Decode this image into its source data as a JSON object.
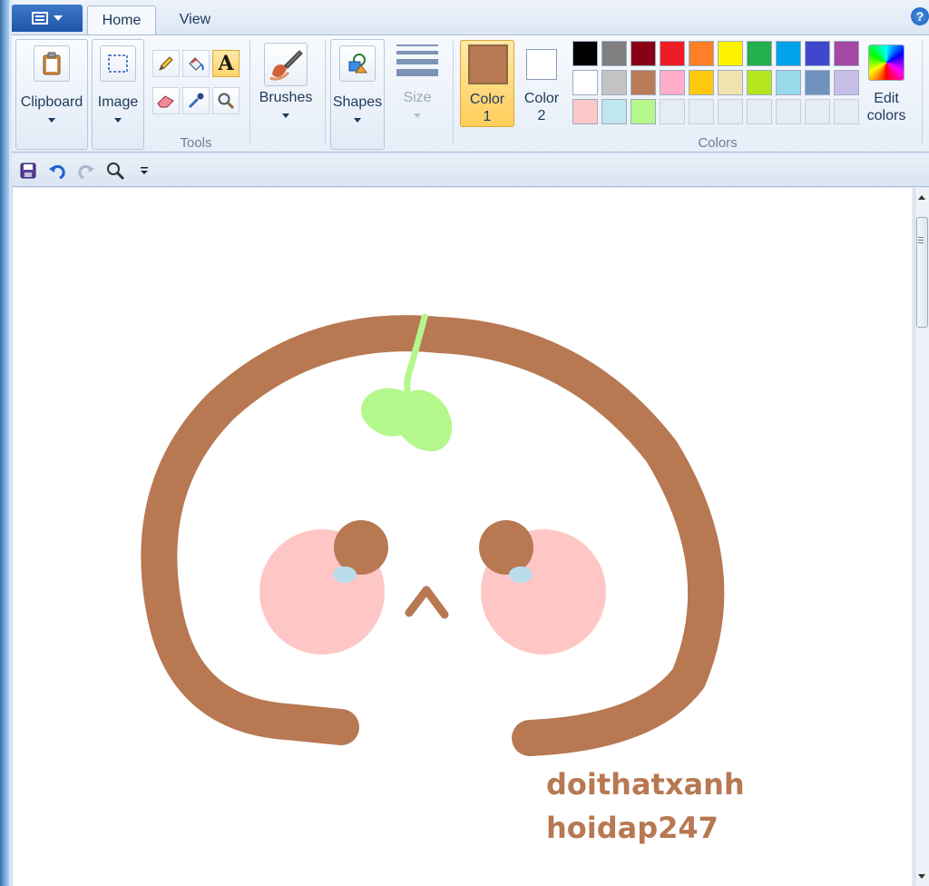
{
  "tabs": {
    "home": "Home",
    "view": "View"
  },
  "help_icon": "?",
  "ribbon": {
    "clipboard_label": "Clipboard",
    "image_label": "Image",
    "tools_group": "Tools",
    "brushes_label": "Brushes",
    "shapes_label": "Shapes",
    "size_label": "Size",
    "color1_label_line1": "Color",
    "color1_label_line2": "1",
    "color2_label_line1": "Color",
    "color2_label_line2": "2",
    "colors_group": "Colors",
    "edit_colors_line1": "Edit",
    "edit_colors_line2": "colors",
    "text_tool_glyph": "A"
  },
  "colors": {
    "color1": "#b77852",
    "color2": "#ffffff",
    "palette_row1": [
      "#000000",
      "#7f7f7f",
      "#880015",
      "#ed1c24",
      "#ff7f27",
      "#fff200",
      "#22b14c",
      "#00a2e8",
      "#3f48cc",
      "#a349a4"
    ],
    "palette_row2": [
      "#ffffff",
      "#c3c3c3",
      "#b97a57",
      "#ffaec9",
      "#ffc90e",
      "#efe4b0",
      "#b5e61d",
      "#99d9ea",
      "#7092be",
      "#c8bfe7"
    ],
    "palette_row3": [
      "#ffc8c8",
      "#c0e6f0",
      "#b4f78c",
      "",
      "",
      "",
      "",
      "",
      "",
      ""
    ],
    "drawing_brown": "#b77852",
    "drawing_pink": "#ffc6c6",
    "drawing_green": "#b4f78c",
    "drawing_tear": "#b8dcec"
  },
  "canvas": {
    "watermark_line1": "doithatxanh",
    "watermark_line2": "hoidap247"
  }
}
